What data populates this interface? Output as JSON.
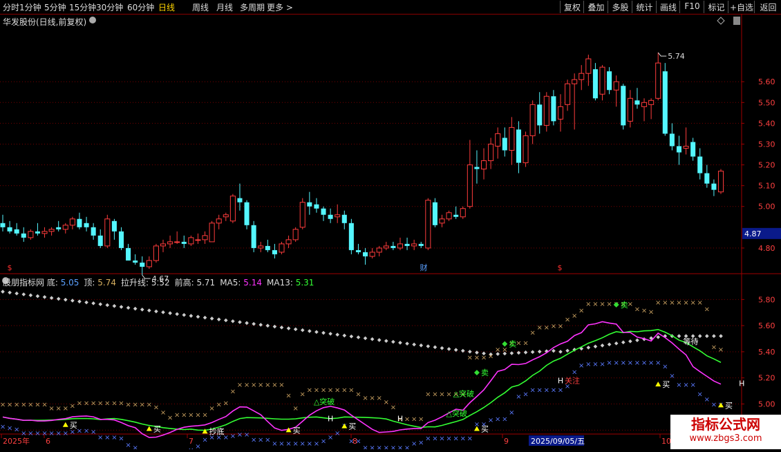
{
  "toolbar": {
    "periods": [
      "分时",
      "1分钟",
      "5分钟",
      "15分钟",
      "30分钟",
      "60分钟",
      "日线",
      "周线",
      "月线",
      "多周期",
      "更多 >"
    ],
    "active_period": "日线",
    "buttons": [
      "复权",
      "叠加",
      "多股",
      "统计",
      "画线",
      "F10",
      "标记",
      "+自选",
      "返回"
    ]
  },
  "colors": {
    "bg": "#000000",
    "up": "#ff3c3c",
    "down": "#54f6ff",
    "grid": "#7a0000",
    "ma5": "#ff33ff",
    "ma13": "#33ff33",
    "bottom_dots": "#cccccc",
    "top_cross": "#c8a060",
    "bottom_cross": "#5a7aff",
    "buy": "#ffff00",
    "sell": "#33dd33",
    "price_box": "#0a1a8a"
  },
  "price_panel": {
    "title": "华发股份(日线,前复权)",
    "current_price": "4.87",
    "high_label": "5.74",
    "low_label": "4.67",
    "event_markers": [
      "$",
      "财",
      "$"
    ]
  },
  "indicator_panel": {
    "name": "股朋指标网",
    "values": [
      {
        "label": "底:",
        "value": "5.05",
        "color": "#5aa0ff"
      },
      {
        "label": "顶:",
        "value": "5.74",
        "color": "#d8b060"
      },
      {
        "label": "拉升线:",
        "value": "5.52",
        "color": "#dddddd"
      },
      {
        "label": "前高:",
        "value": "5.71",
        "color": "#dddddd"
      },
      {
        "label": "MA5:",
        "value": "5.14",
        "color": "#ff33ff"
      },
      {
        "label": "MA13:",
        "value": "5.31",
        "color": "#33ff33"
      }
    ],
    "signals": [
      {
        "text": "买",
        "kind": "buy"
      },
      {
        "text": "抄底",
        "kind": "buy"
      },
      {
        "text": "买",
        "kind": "buy"
      },
      {
        "text": "买",
        "kind": "buy"
      },
      {
        "text": "买",
        "kind": "buy"
      },
      {
        "text": "买",
        "kind": "buy"
      },
      {
        "text": "买",
        "kind": "buy"
      },
      {
        "text": "买",
        "kind": "buy"
      },
      {
        "text": "卖",
        "kind": "sell"
      },
      {
        "text": "卖",
        "kind": "sell"
      },
      {
        "text": "卖",
        "kind": "sell"
      },
      {
        "text": "△突破",
        "kind": "break"
      },
      {
        "text": "△突破",
        "kind": "break"
      },
      {
        "text": "△突破",
        "kind": "break"
      },
      {
        "text": "H",
        "kind": "h"
      },
      {
        "text": "H",
        "kind": "h"
      },
      {
        "text": "H",
        "kind": "h"
      },
      {
        "text": "H",
        "kind": "h"
      },
      {
        "text": "关注",
        "kind": "watch"
      },
      {
        "text": "等待",
        "kind": "wait"
      }
    ]
  },
  "date_axis": {
    "labels": [
      "2025年",
      "6",
      "7",
      "8",
      "9",
      "10"
    ],
    "crosshair_date": "2025/09/05/五"
  },
  "watermark": {
    "line1": "指标公式网",
    "line2": "www.zbgs3.com"
  },
  "chart_data": [
    {
      "type": "candlestick",
      "title": "华发股份(日线,前复权)",
      "ylim": [
        4.68,
        5.86
      ],
      "yticks": [
        4.8,
        5.0,
        5.1,
        5.2,
        5.3,
        5.4,
        5.5,
        5.6
      ],
      "ohlc": [
        [
          4.92,
          4.96,
          4.88,
          4.9
        ],
        [
          4.9,
          4.93,
          4.87,
          4.88
        ],
        [
          4.89,
          4.92,
          4.86,
          4.87
        ],
        [
          4.87,
          4.9,
          4.83,
          4.85
        ],
        [
          4.85,
          4.89,
          4.84,
          4.88
        ],
        [
          4.88,
          4.92,
          4.86,
          4.87
        ],
        [
          4.87,
          4.9,
          4.85,
          4.88
        ],
        [
          4.88,
          4.9,
          4.86,
          4.89
        ],
        [
          4.9,
          4.93,
          4.88,
          4.89
        ],
        [
          4.89,
          4.92,
          4.87,
          4.91
        ],
        [
          4.91,
          4.95,
          4.89,
          4.94
        ],
        [
          4.94,
          4.97,
          4.89,
          4.9
        ],
        [
          4.92,
          4.95,
          4.88,
          4.9
        ],
        [
          4.9,
          4.92,
          4.84,
          4.86
        ],
        [
          4.86,
          4.89,
          4.8,
          4.81
        ],
        [
          4.81,
          4.96,
          4.8,
          4.94
        ],
        [
          4.93,
          4.94,
          4.84,
          4.88
        ],
        [
          4.88,
          4.9,
          4.79,
          4.8
        ],
        [
          4.8,
          4.82,
          4.74,
          4.74
        ],
        [
          4.74,
          4.77,
          4.72,
          4.73
        ],
        [
          4.73,
          4.76,
          4.67,
          4.71
        ],
        [
          4.71,
          4.76,
          4.7,
          4.74
        ],
        [
          4.74,
          4.82,
          4.73,
          4.81
        ],
        [
          4.81,
          4.84,
          4.78,
          4.82
        ],
        [
          4.82,
          4.86,
          4.8,
          4.83
        ],
        [
          4.83,
          4.88,
          4.82,
          4.83
        ],
        [
          4.83,
          4.86,
          4.8,
          4.82
        ],
        [
          4.82,
          4.86,
          4.81,
          4.85
        ],
        [
          4.84,
          4.87,
          4.82,
          4.84
        ],
        [
          4.84,
          4.88,
          4.82,
          4.86
        ],
        [
          4.83,
          4.93,
          4.83,
          4.92
        ],
        [
          4.92,
          4.96,
          4.89,
          4.94
        ],
        [
          4.95,
          4.97,
          4.93,
          4.96
        ],
        [
          4.93,
          5.06,
          4.92,
          5.05
        ],
        [
          5.04,
          5.11,
          4.98,
          5.02
        ],
        [
          5.02,
          5.03,
          4.89,
          4.91
        ],
        [
          4.91,
          4.93,
          4.78,
          4.8
        ],
        [
          4.8,
          4.83,
          4.78,
          4.81
        ],
        [
          4.81,
          4.84,
          4.78,
          4.79
        ],
        [
          4.79,
          4.82,
          4.75,
          4.77
        ],
        [
          4.78,
          4.83,
          4.77,
          4.82
        ],
        [
          4.82,
          4.86,
          4.8,
          4.84
        ],
        [
          4.84,
          4.9,
          4.83,
          4.89
        ],
        [
          4.9,
          5.04,
          4.89,
          5.02
        ],
        [
          5.02,
          5.07,
          4.96,
          5.0
        ],
        [
          5.01,
          5.04,
          4.97,
          4.99
        ],
        [
          4.99,
          5.0,
          4.93,
          4.96
        ],
        [
          4.96,
          4.99,
          4.92,
          4.94
        ],
        [
          4.95,
          5.01,
          4.92,
          4.96
        ],
        [
          4.96,
          4.98,
          4.89,
          4.92
        ],
        [
          4.92,
          4.94,
          4.77,
          4.79
        ],
        [
          4.79,
          4.82,
          4.77,
          4.78
        ],
        [
          4.78,
          4.8,
          4.72,
          4.76
        ],
        [
          4.76,
          4.8,
          4.75,
          4.78
        ],
        [
          4.78,
          4.81,
          4.76,
          4.8
        ],
        [
          4.8,
          4.83,
          4.79,
          4.81
        ],
        [
          4.81,
          4.83,
          4.79,
          4.8
        ],
        [
          4.8,
          4.85,
          4.79,
          4.82
        ],
        [
          4.82,
          4.85,
          4.79,
          4.81
        ],
        [
          4.81,
          4.84,
          4.79,
          4.82
        ],
        [
          4.82,
          4.83,
          4.8,
          4.81
        ],
        [
          4.8,
          5.04,
          4.79,
          5.03
        ],
        [
          5.02,
          5.04,
          4.9,
          4.91
        ],
        [
          4.92,
          4.96,
          4.9,
          4.94
        ],
        [
          4.94,
          4.98,
          4.93,
          4.97
        ],
        [
          4.96,
          5.0,
          4.94,
          4.95
        ],
        [
          4.95,
          5.0,
          4.94,
          4.99
        ],
        [
          5.0,
          5.32,
          4.99,
          5.2
        ],
        [
          5.19,
          5.27,
          5.11,
          5.18
        ],
        [
          5.18,
          5.28,
          5.13,
          5.22
        ],
        [
          5.22,
          5.33,
          5.18,
          5.3
        ],
        [
          5.29,
          5.38,
          5.23,
          5.35
        ],
        [
          5.33,
          5.38,
          5.24,
          5.27
        ],
        [
          5.27,
          5.43,
          5.2,
          5.38
        ],
        [
          5.37,
          5.41,
          5.16,
          5.21
        ],
        [
          5.21,
          5.36,
          5.19,
          5.34
        ],
        [
          5.34,
          5.51,
          5.3,
          5.49
        ],
        [
          5.49,
          5.55,
          5.35,
          5.39
        ],
        [
          5.39,
          5.55,
          5.36,
          5.53
        ],
        [
          5.53,
          5.56,
          5.39,
          5.41
        ],
        [
          5.42,
          5.54,
          5.36,
          5.48
        ],
        [
          5.49,
          5.61,
          5.46,
          5.59
        ],
        [
          5.59,
          5.64,
          5.37,
          5.61
        ],
        [
          5.61,
          5.68,
          5.56,
          5.64
        ],
        [
          5.64,
          5.73,
          5.58,
          5.71
        ],
        [
          5.66,
          5.69,
          5.51,
          5.52
        ],
        [
          5.54,
          5.68,
          5.51,
          5.67
        ],
        [
          5.65,
          5.67,
          5.54,
          5.56
        ],
        [
          5.56,
          5.63,
          5.48,
          5.6
        ],
        [
          5.58,
          5.59,
          5.37,
          5.39
        ],
        [
          5.41,
          5.56,
          5.38,
          5.52
        ],
        [
          5.51,
          5.57,
          5.47,
          5.49
        ],
        [
          5.48,
          5.52,
          5.41,
          5.5
        ],
        [
          5.49,
          5.52,
          5.42,
          5.51
        ],
        [
          5.52,
          5.74,
          5.51,
          5.69
        ],
        [
          5.65,
          5.69,
          5.34,
          5.35
        ],
        [
          5.35,
          5.4,
          5.27,
          5.29
        ],
        [
          5.29,
          5.34,
          5.2,
          5.26
        ],
        [
          5.28,
          5.38,
          5.25,
          5.29
        ],
        [
          5.31,
          5.33,
          5.22,
          5.24
        ],
        [
          5.24,
          5.28,
          5.13,
          5.16
        ],
        [
          5.16,
          5.2,
          5.09,
          5.11
        ],
        [
          5.11,
          5.13,
          5.05,
          5.08
        ],
        [
          5.07,
          5.18,
          5.06,
          5.17
        ]
      ]
    },
    {
      "type": "line",
      "title": "股朋指标网",
      "ylim": [
        4.77,
        5.95
      ],
      "yticks": [
        4.8,
        5.0,
        5.2,
        5.4,
        5.6,
        5.8
      ],
      "ma_period_labels": [
        "MA5",
        "MA13"
      ]
    }
  ]
}
